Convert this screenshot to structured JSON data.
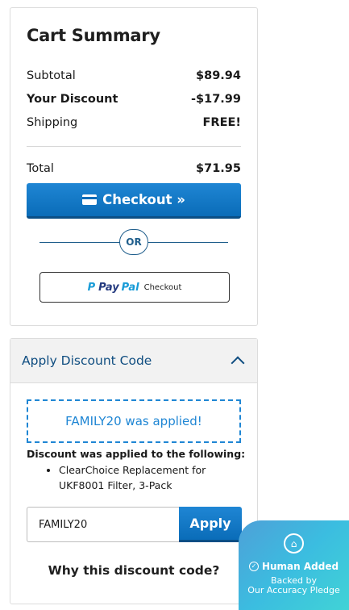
{
  "summary": {
    "title": "Cart Summary",
    "rows": [
      {
        "label": "Subtotal",
        "value": "$89.94"
      },
      {
        "label": "Your Discount",
        "value": "-$17.99"
      },
      {
        "label": "Shipping",
        "value": "FREE!"
      }
    ],
    "total_label": "Total",
    "total_value": "$71.95",
    "checkout_label": "Checkout »",
    "or_label": "OR",
    "paypal": {
      "brand_pay": "Pay",
      "brand_pal": "Pal",
      "checkout_label": "Checkout"
    }
  },
  "discount": {
    "header": "Apply Discount Code",
    "applied_message": "FAMILY20 was applied!",
    "applied_to_label": "Discount was applied to the following:",
    "applied_items": [
      "ClearChoice Replacement for UKF8001 Filter, 3-Pack"
    ],
    "code_value": "FAMILY20",
    "apply_label": "Apply",
    "why_label": "Why this discount code?"
  },
  "badge": {
    "icon": "house-icon",
    "title": "Human Added",
    "line1": "Backed by",
    "line2": "Our Accuracy Pledge"
  },
  "colors": {
    "accent_blue": "#1f86d4",
    "header_blue": "#0f4d80",
    "paypal_dark": "#253b80",
    "paypal_light": "#179bd7"
  }
}
